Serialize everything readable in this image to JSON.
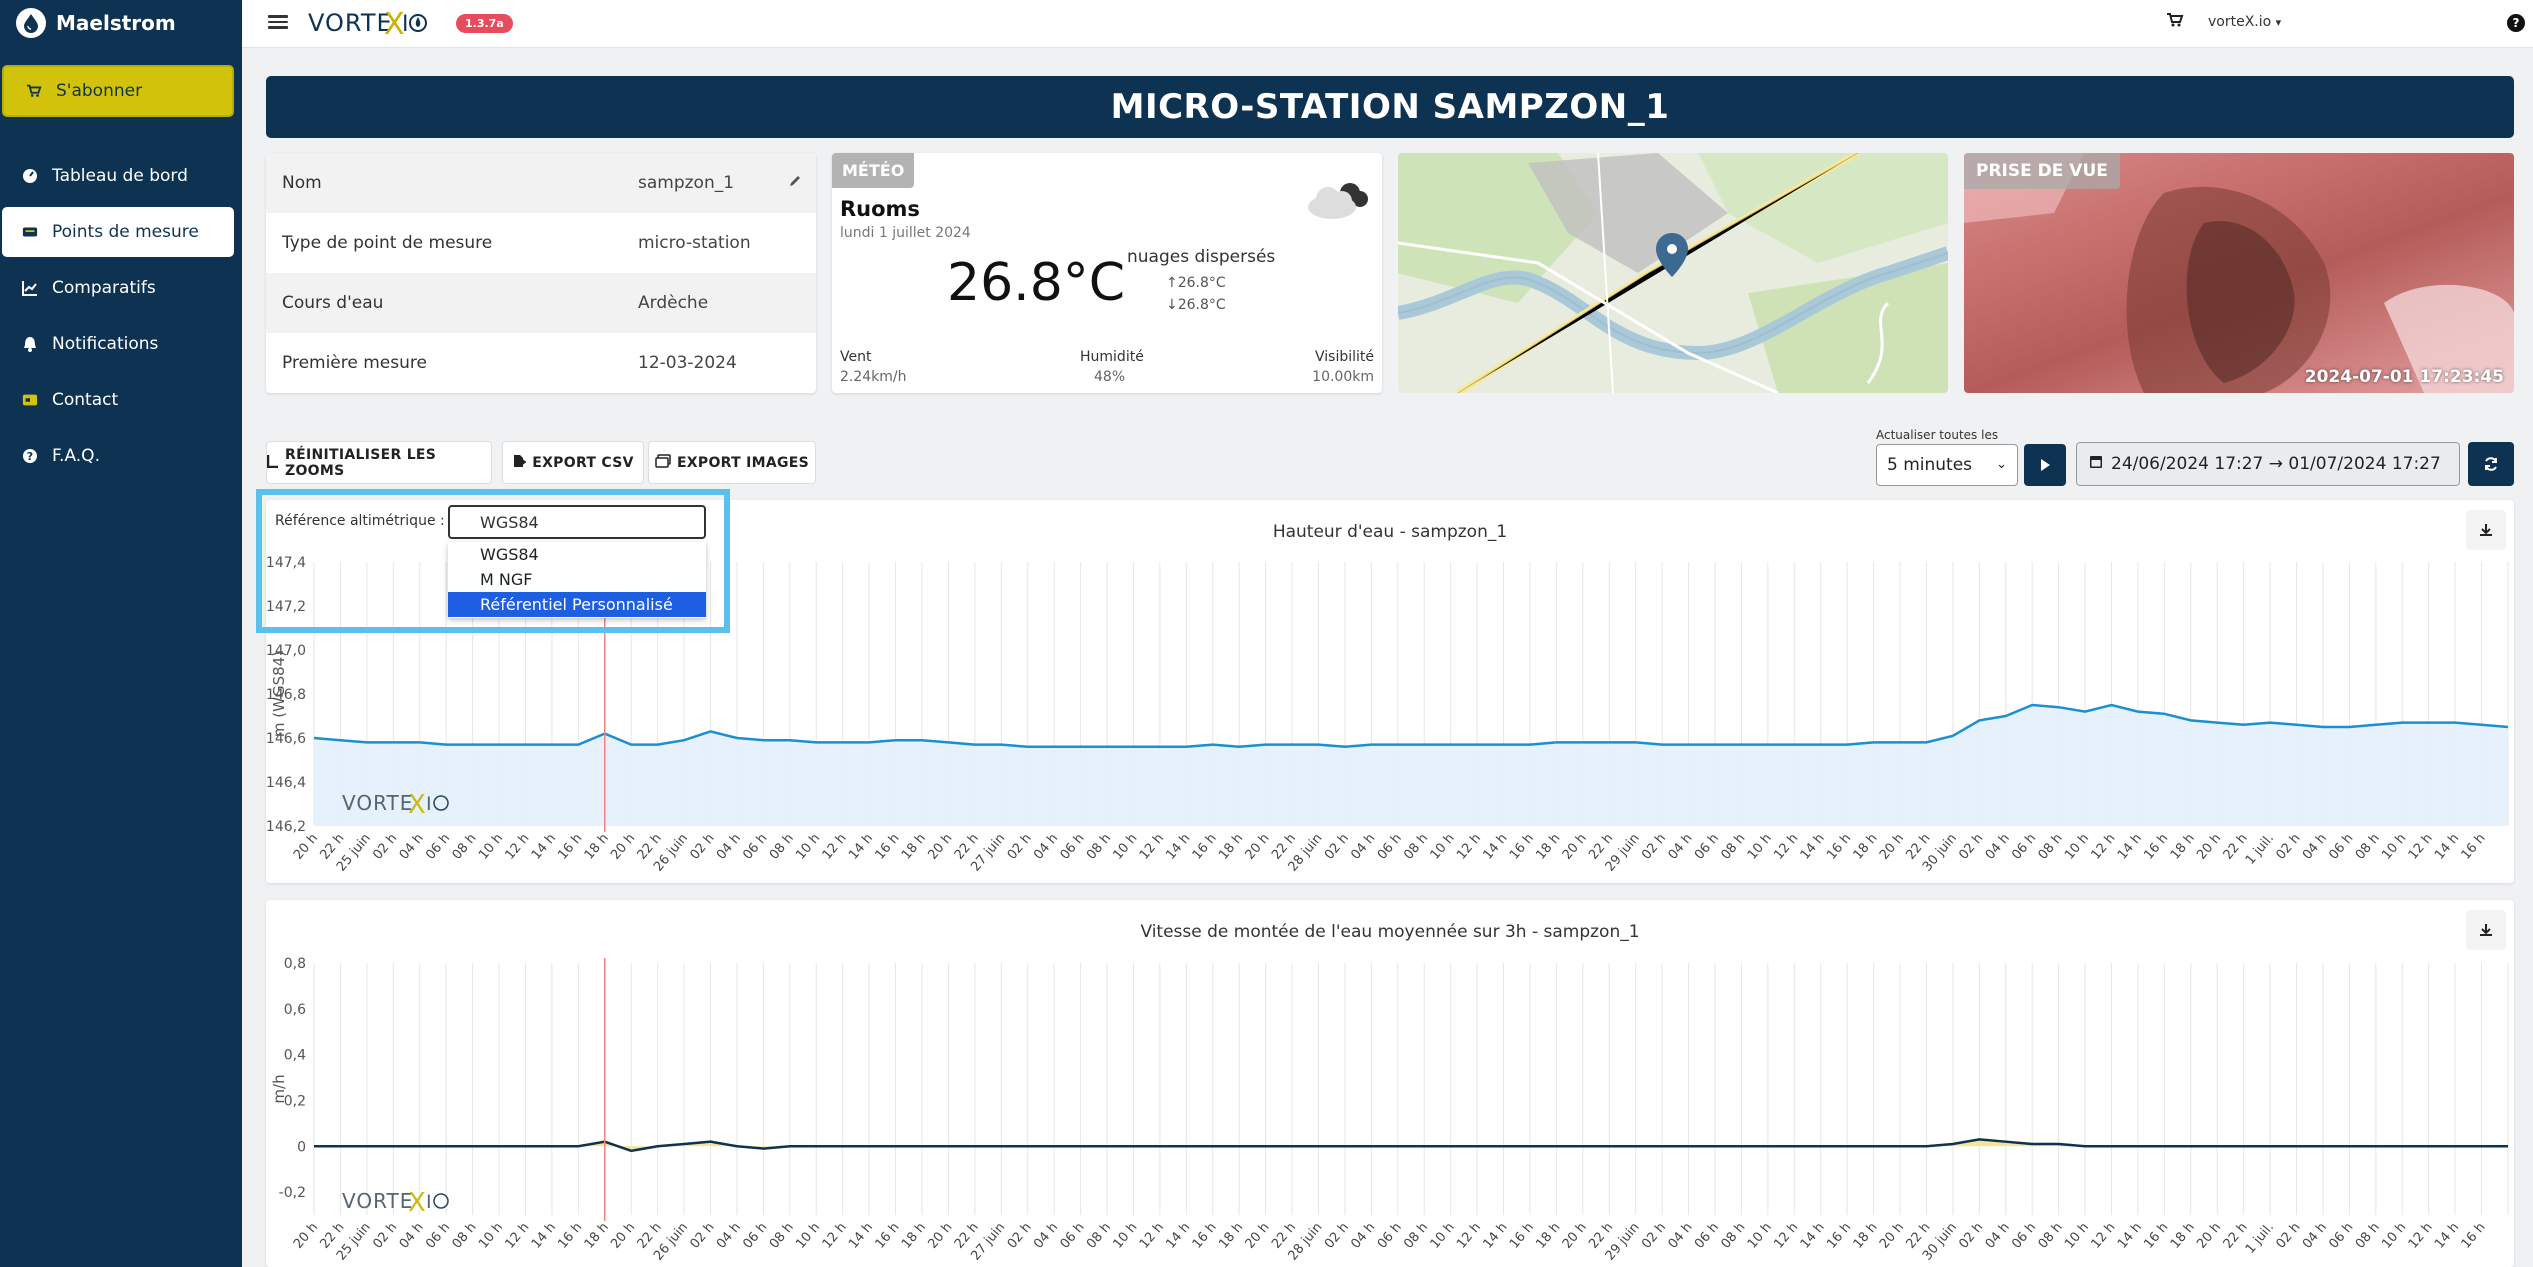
{
  "sidebar": {
    "brand": "Maelstrom",
    "subscribe": "S'abonner",
    "items": [
      {
        "label": "Tableau de bord",
        "icon": "dashboard-icon"
      },
      {
        "label": "Points de mesure",
        "icon": "station-icon"
      },
      {
        "label": "Comparatifs",
        "icon": "chart-line-icon"
      },
      {
        "label": "Notifications",
        "icon": "bell-icon"
      },
      {
        "label": "Contact",
        "icon": "contact-card-icon"
      },
      {
        "label": "F.A.Q.",
        "icon": "question-icon"
      }
    ]
  },
  "topbar": {
    "brand": "VORTEX-IO",
    "version": "1.3.7a",
    "user": "vorteX.io",
    "help": "?"
  },
  "page_title": "MICRO-STATION SAMPZON_1",
  "info": [
    {
      "key": "Nom",
      "value": "sampzon_1"
    },
    {
      "key": "Type de point de mesure",
      "value": "micro-station"
    },
    {
      "key": "Cours d'eau",
      "value": "Ardèche"
    },
    {
      "key": "Première mesure",
      "value": "12-03-2024"
    }
  ],
  "meteo": {
    "badge": "MÉTÉO",
    "city": "Ruoms",
    "date": "lundi 1 juillet 2024",
    "temp": "26.8°C",
    "condition": "nuages dispersés",
    "max": "↑26.8°C",
    "min": "↓26.8°C",
    "wind_label": "Vent",
    "wind": "2.24km/h",
    "humidity_label": "Humidité",
    "humidity": "48%",
    "visibility_label": "Visibilité",
    "visibility": "10.00km"
  },
  "camera": {
    "badge": "PRISE DE VUE",
    "timestamp": "2024-07-01 17:23:45"
  },
  "toolbar": {
    "reset_zoom": "RÉINITIALISER LES ZOOMS",
    "export_csv": "EXPORT CSV",
    "export_images": "EXPORT IMAGES",
    "refresh_label": "Actualiser toutes les",
    "refresh_value": "5 minutes",
    "date_range": "24/06/2024 17:27 → 01/07/2024 17:27"
  },
  "reference": {
    "label": "Référence altimétrique :",
    "value": "WGS84",
    "options": [
      "WGS84",
      "M NGF",
      "Référentiel Personnalisé"
    ],
    "selected_option": "Référentiel Personnalisé"
  },
  "colors": {
    "navy": "#0e3352",
    "accent_yellow": "#d2c30a",
    "line_blue": "#1a8fd1",
    "fill_blue": "#e3f0fb",
    "marker_red": "#f08080",
    "highlight": "#5bc0eb"
  },
  "chart_data": [
    {
      "type": "area",
      "title": "Hauteur d'eau - sampzon_1",
      "ylabel": "m (WGS84)",
      "ylim": [
        146.2,
        147.4
      ],
      "yticks": [
        "147,4",
        "147,2",
        "147,0",
        "146,8",
        "146,6",
        "146,4",
        "146,2"
      ],
      "xticks": [
        "20 h",
        "22 h",
        "25 juin",
        "02 h",
        "04 h",
        "06 h",
        "08 h",
        "10 h",
        "12 h",
        "14 h",
        "16 h",
        "18 h",
        "20 h",
        "22 h",
        "26 juin",
        "02 h",
        "04 h",
        "06 h",
        "08 h",
        "10 h",
        "12 h",
        "14 h",
        "16 h",
        "18 h",
        "20 h",
        "22 h",
        "27 juin",
        "02 h",
        "04 h",
        "06 h",
        "08 h",
        "10 h",
        "12 h",
        "14 h",
        "16 h",
        "18 h",
        "20 h",
        "22 h",
        "28 juin",
        "02 h",
        "04 h",
        "06 h",
        "08 h",
        "10 h",
        "12 h",
        "14 h",
        "16 h",
        "18 h",
        "20 h",
        "22 h",
        "29 juin",
        "02 h",
        "04 h",
        "06 h",
        "08 h",
        "10 h",
        "12 h",
        "14 h",
        "16 h",
        "18 h",
        "20 h",
        "22 h",
        "30 juin",
        "02 h",
        "04 h",
        "06 h",
        "08 h",
        "10 h",
        "12 h",
        "14 h",
        "16 h",
        "18 h",
        "20 h",
        "22 h",
        "1 juil.",
        "02 h",
        "04 h",
        "06 h",
        "08 h",
        "10 h",
        "12 h",
        "14 h",
        "16 h"
      ],
      "x": [
        0,
        2,
        4,
        6,
        8,
        10,
        12,
        14,
        16,
        18,
        20,
        22,
        24,
        26,
        28,
        30,
        32,
        34,
        36,
        38,
        40,
        42,
        44,
        46,
        48,
        50,
        52,
        54,
        56,
        58,
        60,
        62,
        64,
        66,
        68,
        70,
        72,
        74,
        76,
        78,
        80,
        82,
        84,
        86,
        88,
        90,
        92,
        94,
        96,
        98,
        100,
        102,
        104,
        106,
        108,
        110,
        112,
        114,
        116,
        118,
        120,
        122,
        124,
        126,
        128,
        130,
        132,
        134,
        136,
        138,
        140,
        142,
        144,
        146,
        148,
        150,
        152,
        154,
        156,
        158,
        160,
        162,
        164,
        166
      ],
      "values": [
        146.6,
        146.59,
        146.58,
        146.58,
        146.58,
        146.57,
        146.57,
        146.57,
        146.57,
        146.57,
        146.57,
        146.62,
        146.57,
        146.57,
        146.59,
        146.63,
        146.6,
        146.59,
        146.59,
        146.58,
        146.58,
        146.58,
        146.59,
        146.59,
        146.58,
        146.57,
        146.57,
        146.56,
        146.56,
        146.56,
        146.56,
        146.56,
        146.56,
        146.56,
        146.57,
        146.56,
        146.57,
        146.57,
        146.57,
        146.56,
        146.57,
        146.57,
        146.57,
        146.57,
        146.57,
        146.57,
        146.57,
        146.58,
        146.58,
        146.58,
        146.58,
        146.57,
        146.57,
        146.57,
        146.57,
        146.57,
        146.57,
        146.57,
        146.57,
        146.58,
        146.58,
        146.58,
        146.61,
        146.68,
        146.7,
        146.75,
        146.74,
        146.72,
        146.75,
        146.72,
        146.71,
        146.68,
        146.67,
        146.66,
        146.67,
        146.66,
        146.65,
        146.65,
        146.66,
        146.67,
        146.67,
        146.67,
        146.66,
        146.65
      ],
      "marker_x": 22
    },
    {
      "type": "area",
      "title": "Vitesse de montée de l'eau moyennée sur 3h - sampzon_1",
      "ylabel": "m/h",
      "ylim": [
        -0.3,
        0.8
      ],
      "yticks": [
        "0,8",
        "0,6",
        "0,4",
        "0,2",
        "0",
        "-0,2"
      ],
      "xticks": [
        "20 h",
        "22 h",
        "25 juin",
        "02 h",
        "04 h",
        "06 h",
        "08 h",
        "10 h",
        "12 h",
        "14 h",
        "16 h",
        "18 h",
        "20 h",
        "22 h",
        "26 juin",
        "02 h",
        "04 h",
        "06 h",
        "08 h",
        "10 h",
        "12 h",
        "14 h",
        "16 h",
        "18 h",
        "20 h",
        "22 h",
        "27 juin",
        "02 h",
        "04 h",
        "06 h",
        "08 h",
        "10 h",
        "12 h",
        "14 h",
        "16 h",
        "18 h",
        "20 h",
        "22 h",
        "28 juin",
        "02 h",
        "04 h",
        "06 h",
        "08 h",
        "10 h",
        "12 h",
        "14 h",
        "16 h",
        "18 h",
        "20 h",
        "22 h",
        "29 juin",
        "02 h",
        "04 h",
        "06 h",
        "08 h",
        "10 h",
        "12 h",
        "14 h",
        "16 h",
        "18 h",
        "20 h",
        "22 h",
        "30 juin",
        "02 h",
        "04 h",
        "06 h",
        "08 h",
        "10 h",
        "12 h",
        "14 h",
        "16 h",
        "18 h",
        "20 h",
        "22 h",
        "1 juil.",
        "02 h",
        "04 h",
        "06 h",
        "08 h",
        "10 h",
        "12 h",
        "14 h",
        "16 h"
      ],
      "x": [
        0,
        2,
        4,
        6,
        8,
        10,
        12,
        14,
        16,
        18,
        20,
        22,
        24,
        26,
        28,
        30,
        32,
        34,
        36,
        38,
        40,
        42,
        44,
        46,
        48,
        50,
        52,
        54,
        56,
        58,
        60,
        62,
        64,
        66,
        68,
        70,
        72,
        74,
        76,
        78,
        80,
        82,
        84,
        86,
        88,
        90,
        92,
        94,
        96,
        98,
        100,
        102,
        104,
        106,
        108,
        110,
        112,
        114,
        116,
        118,
        120,
        122,
        124,
        126,
        128,
        130,
        132,
        134,
        136,
        138,
        140,
        142,
        144,
        146,
        148,
        150,
        152,
        154,
        156,
        158,
        160,
        162,
        164,
        166
      ],
      "values": [
        0,
        0,
        0,
        0,
        0,
        0,
        0,
        0,
        0,
        0,
        0,
        0.02,
        -0.02,
        0,
        0.01,
        0.02,
        0,
        -0.01,
        0,
        0,
        0,
        0,
        0,
        0,
        0,
        0,
        0,
        0,
        0,
        0,
        0,
        0,
        0,
        0,
        0,
        0,
        0,
        0,
        0,
        0,
        0,
        0,
        0,
        0,
        0,
        0,
        0,
        0,
        0,
        0,
        0,
        0,
        0,
        0,
        0,
        0,
        0,
        0,
        0,
        0,
        0,
        0,
        0.01,
        0.03,
        0.02,
        0.01,
        0.01,
        0,
        0,
        0,
        0,
        0,
        0,
        0,
        0,
        0,
        0,
        0,
        0,
        0,
        0,
        0,
        0,
        0
      ],
      "marker_x": 22
    }
  ]
}
